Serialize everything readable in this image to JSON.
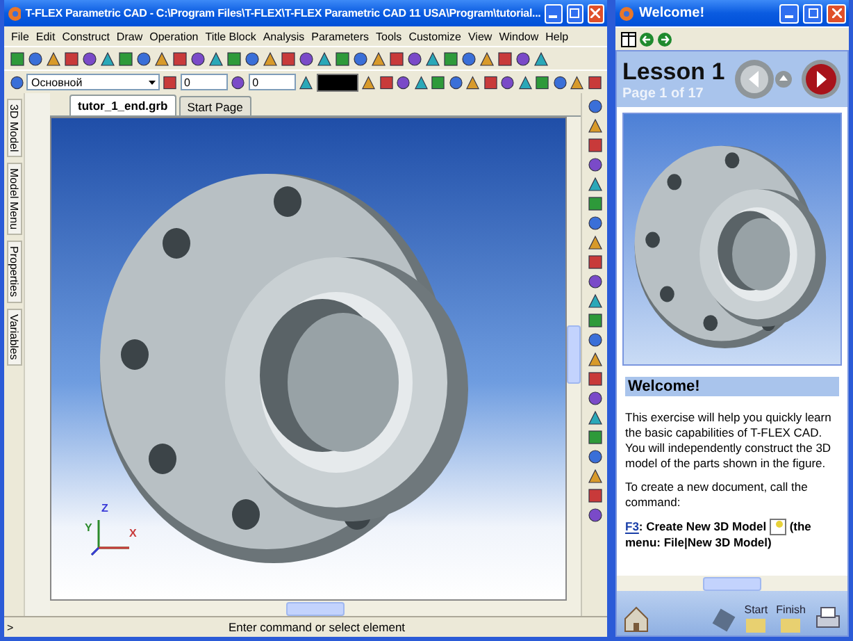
{
  "main_window": {
    "title": "T-FLEX Parametric CAD - C:\\Program Files\\T-FLEX\\T-FLEX Parametric CAD 11 USA\\Program\\tutorial...",
    "menu": [
      "File",
      "Edit",
      "Construct",
      "Draw",
      "Operation",
      "Title Block",
      "Analysis",
      "Parameters",
      "Tools",
      "Customize",
      "View",
      "Window",
      "Help"
    ],
    "style_combo": "Основной",
    "layer_spin": "0",
    "level_spin": "0",
    "tabs": [
      {
        "label": "tutor_1_end.grb",
        "selected": true
      },
      {
        "label": "Start Page",
        "selected": false
      }
    ],
    "side_tabs": [
      "3D Model",
      "Model Menu",
      "Properties",
      "Variables"
    ],
    "axes": [
      "X",
      "Y",
      "Z"
    ],
    "status": {
      "prompt": ">",
      "message": "Enter command or select element"
    }
  },
  "welcome_window": {
    "title": "Welcome!",
    "lesson": "Lesson 1",
    "page": "Page 1 of 17",
    "heading": "Welcome!",
    "paragraphs": [
      "This exercise will help you quickly learn the basic capabilities of T-FLEX CAD. You will independently construct the 3D model of the parts shown in the figure.",
      "To create a new document, call the command:"
    ],
    "command": {
      "key": "F3",
      "text": ": Create New 3D Model",
      "menu_path": "(the menu: File|New 3D Model)"
    },
    "footer": [
      "Start",
      "Finish"
    ]
  }
}
